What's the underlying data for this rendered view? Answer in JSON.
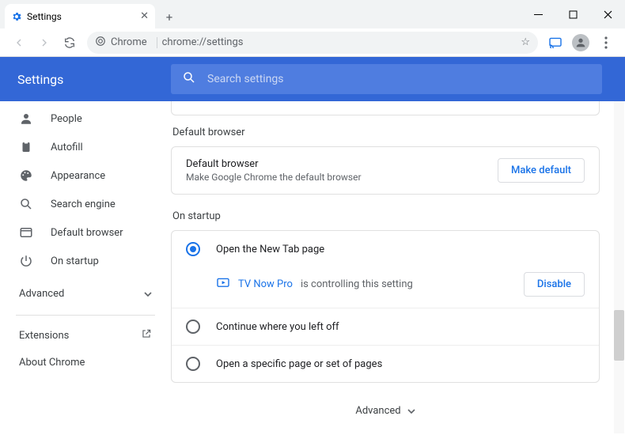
{
  "window": {
    "tab_title": "Settings"
  },
  "address": {
    "scheme": "Chrome",
    "url": "chrome://settings"
  },
  "bluebar": {
    "title": "Settings",
    "search_placeholder": "Search settings"
  },
  "sidebar": {
    "items": [
      {
        "label": "People"
      },
      {
        "label": "Autofill"
      },
      {
        "label": "Appearance"
      },
      {
        "label": "Search engine"
      },
      {
        "label": "Default browser"
      },
      {
        "label": "On startup"
      }
    ],
    "advanced": "Advanced",
    "extensions": "Extensions",
    "about": "About Chrome"
  },
  "sections": {
    "default_browser": {
      "title": "Default browser",
      "row_title": "Default browser",
      "row_sub": "Make Google Chrome the default browser",
      "button": "Make default"
    },
    "startup": {
      "title": "On startup",
      "options": [
        "Open the New Tab page",
        "Continue where you left off",
        "Open a specific page or set of pages"
      ],
      "controlling_ext": "TV Now Pro",
      "controlling_msg": "is controlling this setting",
      "disable": "Disable"
    },
    "footer_advanced": "Advanced"
  }
}
